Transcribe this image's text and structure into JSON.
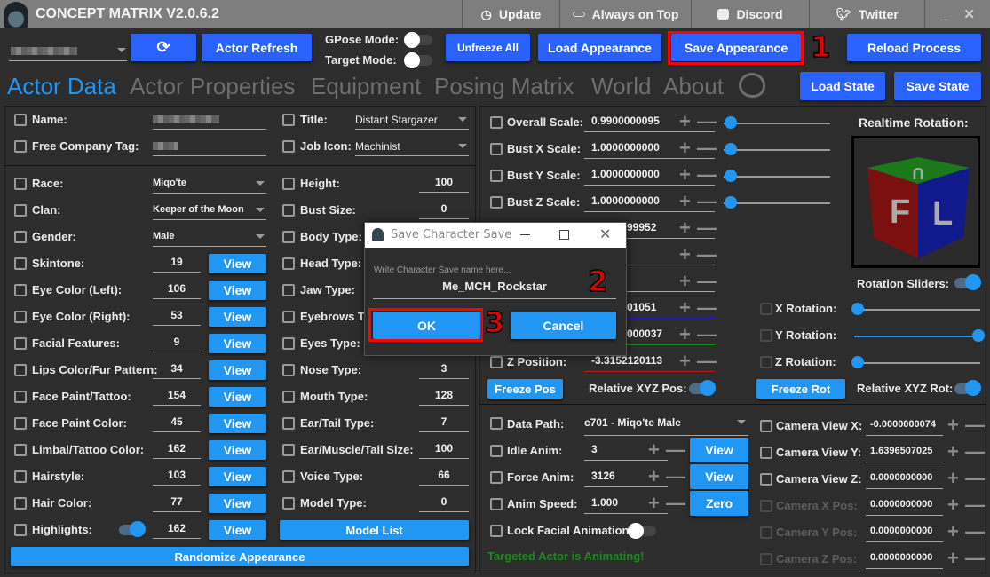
{
  "app": {
    "title": "CONCEPT MATRIX V2.0.6.2"
  },
  "titlebar": {
    "buttons": [
      {
        "label": "Update",
        "icon": "update-clock-icon"
      },
      {
        "label": "Always on Top",
        "icon": "pin-icon"
      },
      {
        "label": "Discord",
        "icon": "discord-icon"
      },
      {
        "label": "Twitter",
        "icon": "twitter-icon"
      }
    ],
    "minimize": "_",
    "close": "✕"
  },
  "toolbar": {
    "actor_refresh": "Actor Refresh",
    "gpose_mode": "GPose Mode:",
    "target_mode": "Target Mode:",
    "gpose_on": false,
    "target_on": false,
    "unfreeze_all": "Unfreeze All",
    "load_appearance": "Load Appearance",
    "save_appearance": "Save Appearance",
    "reload_process": "Reload Process",
    "load_state": "Load State",
    "save_state": "Save State"
  },
  "tabs": [
    "Actor Data",
    "Actor Properties",
    "Equipment",
    "Posing Matrix",
    "World",
    "About"
  ],
  "active_tab": "Actor Data",
  "identity": {
    "name_label": "Name:",
    "fc_label": "Free Company Tag:",
    "title_label": "Title:",
    "title_value": "Distant Stargazer",
    "job_label": "Job Icon:",
    "job_value": "Machinist"
  },
  "left_rows": [
    {
      "label": "Race:",
      "value": "Miqo'te",
      "kind": "select"
    },
    {
      "label": "Clan:",
      "value": "Keeper of the Moon",
      "kind": "select"
    },
    {
      "label": "Gender:",
      "value": "Male",
      "kind": "select"
    },
    {
      "label": "Skintone:",
      "value": "19",
      "kind": "view"
    },
    {
      "label": "Eye Color (Left):",
      "value": "106",
      "kind": "view"
    },
    {
      "label": "Eye Color (Right):",
      "value": "53",
      "kind": "view"
    },
    {
      "label": "Facial Features:",
      "value": "9",
      "kind": "view"
    },
    {
      "label": "Lips Color/Fur Pattern:",
      "value": "34",
      "kind": "view"
    },
    {
      "label": "Face Paint/Tattoo:",
      "value": "154",
      "kind": "view"
    },
    {
      "label": "Face Paint Color:",
      "value": "45",
      "kind": "view"
    },
    {
      "label": "Limbal/Tattoo Color:",
      "value": "162",
      "kind": "view"
    },
    {
      "label": "Hairstyle:",
      "value": "103",
      "kind": "view"
    },
    {
      "label": "Hair Color:",
      "value": "77",
      "kind": "view"
    },
    {
      "label": "Highlights:",
      "value": "162",
      "kind": "view",
      "toggle_on": true
    }
  ],
  "view_label": "View",
  "mid_rows": [
    {
      "label": "Height:",
      "value": "100"
    },
    {
      "label": "Bust Size:",
      "value": "0"
    },
    {
      "label": "Body Type:",
      "value": ""
    },
    {
      "label": "Head Type:",
      "value": ""
    },
    {
      "label": "Jaw Type:",
      "value": ""
    },
    {
      "label": "Eyebrows Ty",
      "value": ""
    },
    {
      "label": "Eyes Type:",
      "value": ""
    },
    {
      "label": "Nose Type:",
      "value": "3"
    },
    {
      "label": "Mouth Type:",
      "value": "128"
    },
    {
      "label": "Ear/Tail Type:",
      "value": "7"
    },
    {
      "label": "Ear/Muscle/Tail Size:",
      "value": "100"
    },
    {
      "label": "Voice Type:",
      "value": "66"
    },
    {
      "label": "Model Type:",
      "value": "0"
    }
  ],
  "model_list": "Model List",
  "randomize": "Randomize Appearance",
  "scale_rows": [
    {
      "label": "Overall Scale:",
      "value": "0.9900000095",
      "slider": 0.0
    },
    {
      "label": "Bust X Scale:",
      "value": "1.0000000000",
      "slider": 0.0
    },
    {
      "label": "Bust Y Scale:",
      "value": "1.0000000000",
      "slider": 0.0
    },
    {
      "label": "Bust Z Scale:",
      "value": "1.0000000000",
      "slider": 0.0
    },
    {
      "label": "",
      "value": "99952"
    },
    {
      "label": "",
      "value": ""
    },
    {
      "label": "",
      "value": ""
    },
    {
      "label": "",
      "value": "01051",
      "underline": "#1a1ad0"
    },
    {
      "label": "",
      "value": "000037",
      "underline": "#1a8a1a"
    },
    {
      "label": "Z Position:",
      "value": "-3.3152120113",
      "underline": "#c01818"
    }
  ],
  "freeze_pos": "Freeze Pos",
  "relative_pos": "Relative XYZ Pos:",
  "relative_pos_on": true,
  "rotation": {
    "title": "Realtime Rotation:",
    "cube_faces": {
      "front": "F",
      "side": "L",
      "top": "U"
    },
    "colors": {
      "front": "#7a1010",
      "side": "#101a8a",
      "top": "#1a7a1a"
    },
    "sliders_label": "Rotation Sliders:",
    "sliders_on": true,
    "rows": [
      {
        "label": "X Rotation:",
        "value": 0.0
      },
      {
        "label": "Y Rotation:",
        "value": 1.0
      },
      {
        "label": "Z Rotation:",
        "value": 0.0
      }
    ],
    "freeze_rot": "Freeze Rot",
    "relative_rot": "Relative XYZ Rot:",
    "relative_rot_on": true
  },
  "anim": {
    "data_path_label": "Data Path:",
    "data_path_value": "c701 - Miqo'te Male",
    "rows": [
      {
        "label": "Idle Anim:",
        "value": "3",
        "button": "View"
      },
      {
        "label": "Force Anim:",
        "value": "3126",
        "button": "View"
      },
      {
        "label": "Anim Speed:",
        "value": "1.000",
        "button": "Zero"
      }
    ],
    "lock_facial": "Lock Facial Animation:",
    "lock_facial_on": false,
    "status": "Targeted Actor is Animating!",
    "status_color": "#1a8a1a"
  },
  "camera_rows": [
    {
      "label": "Camera View X:",
      "value": "-0.0000000074",
      "enabled": true
    },
    {
      "label": "Camera View Y:",
      "value": "1.6396507025",
      "enabled": true
    },
    {
      "label": "Camera View Z:",
      "value": "0.0000000000",
      "enabled": true
    },
    {
      "label": "Camera X Pos:",
      "value": "0.0000000000",
      "enabled": false
    },
    {
      "label": "Camera Y Pos:",
      "value": "0.0000000000",
      "enabled": false
    },
    {
      "label": "Camera Z Pos:",
      "value": "0.0000000000",
      "enabled": false
    }
  ],
  "dialog": {
    "title": "Save Character Save",
    "placeholder": "Write Character Save name here...",
    "value": "Me_MCH_Rockstar",
    "ok": "OK",
    "cancel": "Cancel"
  },
  "annotations": [
    "1",
    "2",
    "3"
  ],
  "colors": {
    "accent": "#2962ff",
    "button": "#2196f3",
    "highlight": "#ff0000",
    "background": "#2d2d2d",
    "titlebar": "#7e7e7e"
  }
}
